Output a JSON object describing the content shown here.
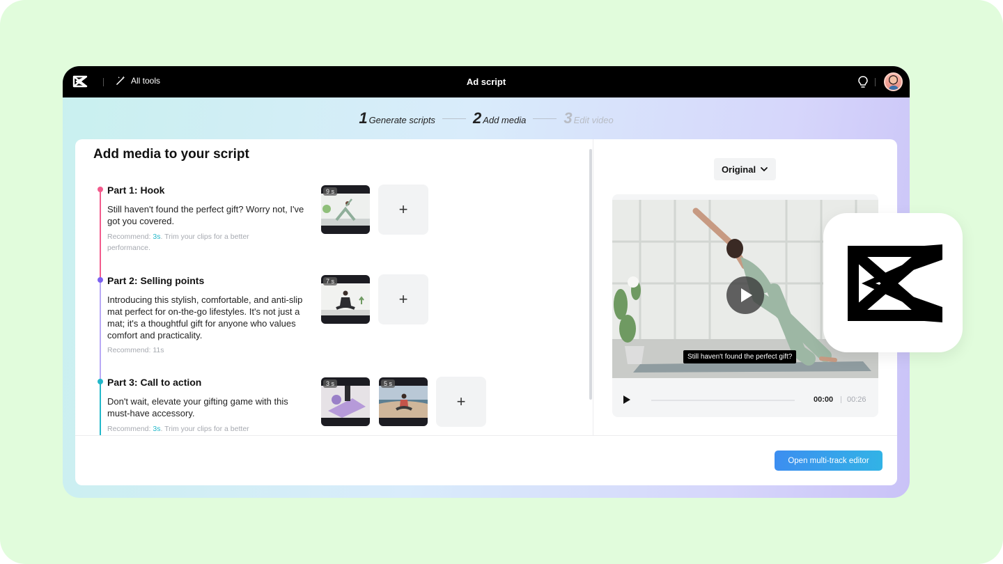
{
  "topbar": {
    "all_tools": "All tools",
    "title": "Ad script",
    "icons": [
      "capcut-logo-icon",
      "magic-wand-icon",
      "lightbulb-icon",
      "avatar"
    ]
  },
  "steps": [
    {
      "num": "1",
      "label": "Generate scripts",
      "state": "done"
    },
    {
      "num": "2",
      "label": "Add media",
      "state": "active"
    },
    {
      "num": "3",
      "label": "Edit video",
      "state": "disabled"
    }
  ],
  "main": {
    "title": "Add media to your script",
    "parts": [
      {
        "title": "Part 1: Hook",
        "color": "#f25a8c",
        "desc": "Still haven't found the perfect gift? Worry not, I've got you covered.",
        "rec_prefix": "Recommend: ",
        "rec_value": "3s",
        "rec_suffix": ". Trim your clips for a better performance.",
        "clips": [
          "9 s"
        ]
      },
      {
        "title": "Part 2: Selling points",
        "color": "#7b61f0",
        "desc": "Introducing this stylish, comfortable, and anti-slip mat perfect for on-the-go lifestyles. It's not just a mat; it's a thoughtful gift for anyone who values comfort and practicality.",
        "rec_prefix": "Recommend: 11s",
        "rec_value": "",
        "rec_suffix": "",
        "clips": [
          "7 s"
        ]
      },
      {
        "title": "Part 3: Call to action",
        "color": "#22b7c9",
        "desc": "Don't wait, elevate your gifting game with this must-have accessory.",
        "rec_prefix": "Recommend: ",
        "rec_value": "3s",
        "rec_suffix": ". Trim your clips for a better",
        "clips": [
          "3 s",
          "5 s"
        ]
      }
    ],
    "add_symbol": "+"
  },
  "preview": {
    "ratio_label": "Original",
    "caption": "Still haven't found the perfect gift?",
    "time_current": "00:00",
    "time_total": "00:26",
    "progress": 0
  },
  "footer": {
    "open_editor": "Open multi-track editor"
  },
  "colors": {
    "accent": "#3c8ef0",
    "page_bg": "#e1fcdc"
  }
}
